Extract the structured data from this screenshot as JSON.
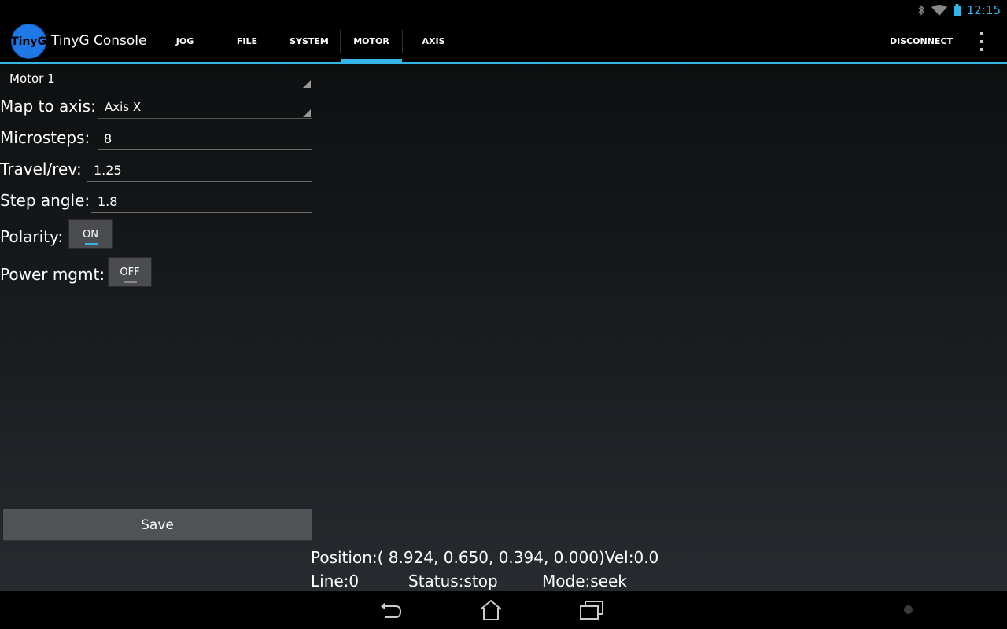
{
  "status_bar": {
    "time": "12:15"
  },
  "app": {
    "logo_text": "TinyG",
    "title": "TinyG Console"
  },
  "tabs": [
    {
      "label": "JOG"
    },
    {
      "label": "FILE"
    },
    {
      "label": "SYSTEM"
    },
    {
      "label": "MOTOR",
      "selected": true
    },
    {
      "label": "AXIS"
    }
  ],
  "actions": {
    "disconnect": "DISCONNECT"
  },
  "motor_form": {
    "motor_select": "Motor 1",
    "map_to_axis_label": "Map to axis:",
    "map_to_axis_value": "Axis X",
    "microsteps_label": "Microsteps:",
    "microsteps_value": "8",
    "travel_rev_label": "Travel/rev:",
    "travel_rev_value": "1.25",
    "step_angle_label": "Step angle:",
    "step_angle_value": "1.8",
    "polarity_label": "Polarity:",
    "polarity_value": "ON",
    "power_mgmt_label": "Power mgmt:",
    "power_mgmt_value": "OFF",
    "save_label": "Save"
  },
  "machine_status": {
    "position_text": "Position:( 8.924, 0.650, 0.394, 0.000)Vel:0.0",
    "line_text": "Line:0",
    "status_text": "Status:stop",
    "mode_text": "Mode:seek"
  },
  "colors": {
    "accent": "#33b5e5",
    "toggle_on_indicator": "#33b5e5",
    "toggle_off_indicator": "#888888"
  },
  "icons": [
    "bluetooth-icon",
    "wifi-icon",
    "battery-icon",
    "overflow-menu-icon",
    "back-icon",
    "home-icon",
    "recent-apps-icon"
  ]
}
